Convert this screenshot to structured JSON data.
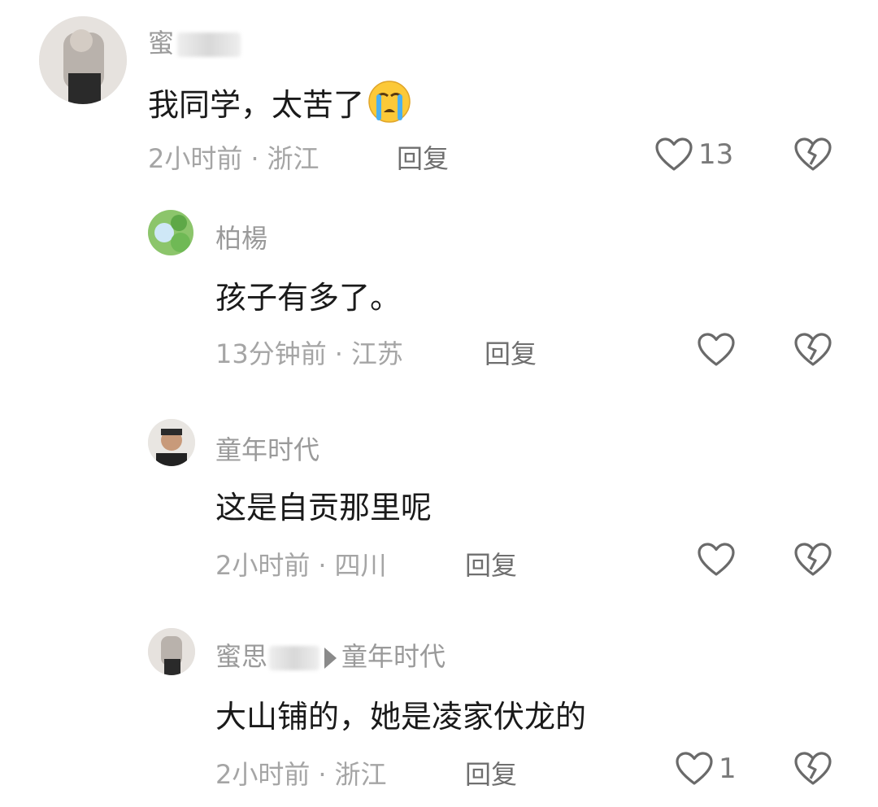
{
  "comments": [
    {
      "username": "蜜",
      "text": "我同学，太苦了",
      "emoji": "crying-face",
      "time": "2小时前",
      "location": "浙江",
      "reply_label": "回复",
      "likes": "13"
    },
    {
      "username": "柏楊",
      "text": "孩子有多了。",
      "time": "13分钟前",
      "location": "江苏",
      "reply_label": "回复",
      "likes": ""
    },
    {
      "username": "童年时代",
      "text": "这是自贡那里呢",
      "time": "2小时前",
      "location": "四川",
      "reply_label": "回复",
      "likes": ""
    },
    {
      "username": "蜜思",
      "reply_to": "童年时代",
      "text": "大山铺的，她是凌家伏龙的",
      "time": "2小时前",
      "location": "浙江",
      "reply_label": "回复",
      "likes": "1"
    }
  ],
  "separator": "·",
  "colors": {
    "text": "#1a1a1a",
    "meta": "#a5a5a5",
    "username": "#9a9a9a",
    "icon": "#707070"
  }
}
